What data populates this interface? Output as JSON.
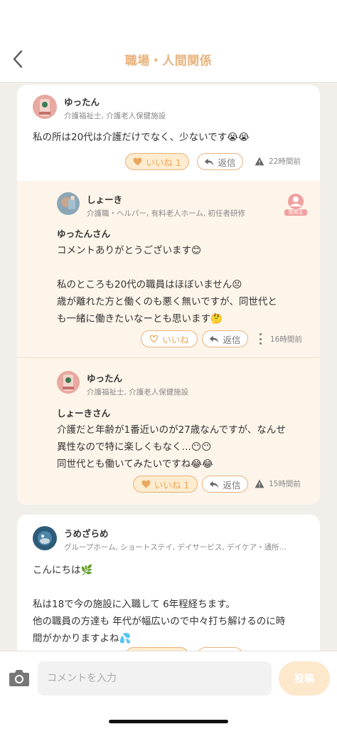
{
  "header": {
    "title": "職場・人間関係"
  },
  "comment1": {
    "user": "ゆったん",
    "profile": "介護福祉士, 介護老人保健施設",
    "body": "私の所は20代は介護だけでなく、少ないです😭😭",
    "like_label": "いいね 1",
    "reply_label": "返信",
    "time": "22時間前",
    "replies": [
      {
        "user": "しょーき",
        "profile": "介護職・ヘルパー, 有料老人ホーム, 初任者研修",
        "badge": "質問主",
        "mention": "ゆったんさん",
        "body": "コメントありがとうございます😊\n\n私のところも20代の職員はほぼいません😣\n歳が離れた方と働くのも悪く無いですが、同世代と\nも一緒に働きたいなーとも思います🤔",
        "like_label": "いいね",
        "reply_label": "返信",
        "time": "16時間前"
      },
      {
        "user": "ゆったん",
        "profile": "介護福祉士, 介護老人保健施設",
        "mention": "しょーきさん",
        "body": "介護だと年齢が1番近いのが27歳なんですが、なんせ\n異性なので特に楽しくもなく…😶😶\n同世代とも働いてみたいですね😂😂",
        "like_label": "いいね 1",
        "reply_label": "返信",
        "time": "15時間前"
      }
    ]
  },
  "comment2": {
    "user": "うめざらめ",
    "profile": "グループホーム, ショートステイ, デイサービス, デイケア・通所…",
    "body": "こんにちは🌿\n\n私は18で今の施設に入職して 6年程経ちます。\n他の職員の方達も 年代が幅広いので中々打ち解けるのに時\n間がかかりますよね💦"
  },
  "input": {
    "placeholder": "コメントを入力",
    "post_label": "投稿"
  },
  "colors": {
    "accent": "#e8b37e",
    "reply_bg": "#fdf5ea",
    "like_bg": "#fdeccf",
    "post_btn": "#fde8cc"
  },
  "icons": [
    "back-chevron-icon",
    "heart-icon",
    "reply-arrow-icon",
    "warning-icon",
    "kebab-icon",
    "person-badge-icon",
    "camera-icon"
  ]
}
